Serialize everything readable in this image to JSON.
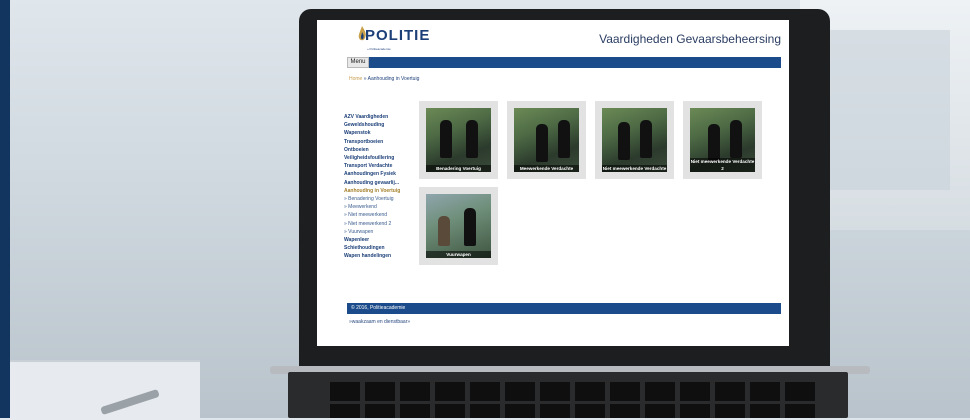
{
  "site": {
    "logo_text": "POLITIE",
    "logo_subtitle": "» Politieacademie",
    "title": "Vaardigheden Gevaarsbeheersing"
  },
  "menu": {
    "label": "Menu"
  },
  "breadcrumb": {
    "home": "Home",
    "separator": "»",
    "current": "Aanhouding in Voertuig"
  },
  "sidebar": {
    "items": [
      {
        "label": "AZV Vaardigheden",
        "state": "normal"
      },
      {
        "label": "Geweldshouding",
        "state": "normal"
      },
      {
        "label": "Wapenstok",
        "state": "normal"
      },
      {
        "label": "Transportboeien",
        "state": "normal"
      },
      {
        "label": "Ontboeien",
        "state": "normal"
      },
      {
        "label": "Veiligheidsfouillering",
        "state": "normal"
      },
      {
        "label": "Transport Verdachte",
        "state": "normal"
      },
      {
        "label": "Aanhoudingen Fysiek",
        "state": "normal"
      },
      {
        "label": "Aanhouding gevaarlij...",
        "state": "normal"
      },
      {
        "label": "Aanhouding in Voertuig",
        "state": "active"
      },
      {
        "label": "» Benadering Voertuig",
        "state": "sub"
      },
      {
        "label": "» Meewerkend",
        "state": "sub"
      },
      {
        "label": "» Niet meewerkend",
        "state": "sub"
      },
      {
        "label": "» Niet meewerkend 2",
        "state": "sub"
      },
      {
        "label": "» Vuurwapen",
        "state": "sub"
      },
      {
        "label": "Wapenleer",
        "state": "normal"
      },
      {
        "label": "Schiethoudingen",
        "state": "normal"
      },
      {
        "label": "Wapen handelingen",
        "state": "normal"
      }
    ]
  },
  "tiles": [
    {
      "caption": "Benadering Voertuig"
    },
    {
      "caption": "Meewerkende Verdachte"
    },
    {
      "caption": "Niet meewerkende Verdachte"
    },
    {
      "caption": "Niet meewerkende Verdachte 2"
    },
    {
      "caption": "Vuurwapen"
    }
  ],
  "footer": {
    "copyright": "© 2016, Politieacademie",
    "slogan": "»waakzaam en dienstbaar»"
  },
  "colors": {
    "brand_blue": "#1b4b8a",
    "active_gold": "#a37f2a",
    "side_bar": "#12355f"
  }
}
